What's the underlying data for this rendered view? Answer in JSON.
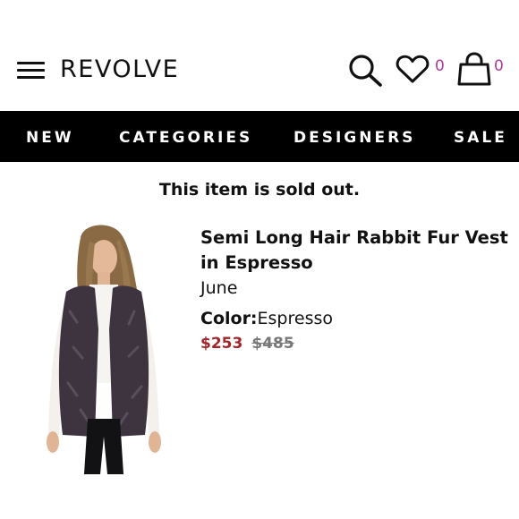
{
  "brand": {
    "logo": "REVOLVE"
  },
  "header": {
    "icons": [
      "hamburger-menu-icon",
      "search-icon",
      "heart-icon",
      "shopping-bag-icon"
    ],
    "wishlist_count": "0",
    "bag_count": "0",
    "badge_color": "#b0399c"
  },
  "nav": {
    "items": [
      {
        "label": "NEW"
      },
      {
        "label": "CATEGORIES"
      },
      {
        "label": "DESIGNERS"
      },
      {
        "label": "SALE"
      }
    ],
    "background": "#000000"
  },
  "status": {
    "message": "This item is sold out."
  },
  "product": {
    "title": "Semi Long Hair Rabbit Fur Vest in Espresso",
    "designer": "June",
    "color_label": "Color:",
    "color_value": "Espresso",
    "sale_price": "$253",
    "original_price": "$485",
    "sale_color": "#a0262b"
  }
}
